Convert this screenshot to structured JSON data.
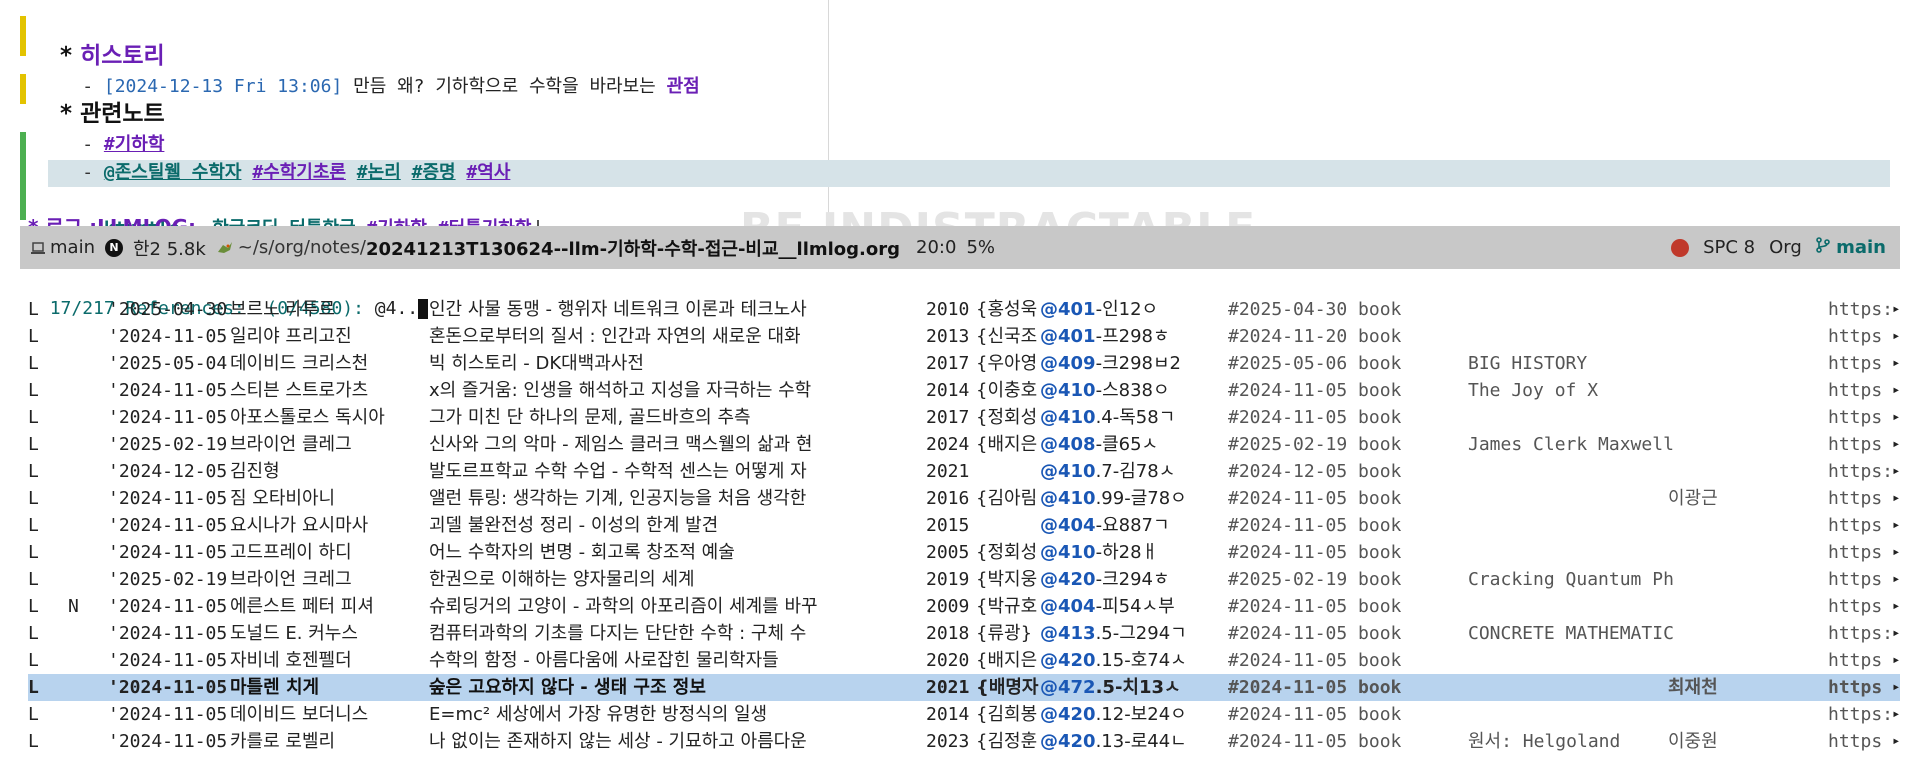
{
  "org": {
    "history_heading": "히스토리",
    "history_ts": "[2024-12-13 Fri 13:06]",
    "history_text": " 만듬 왜? 기하학으로 수학을 바라보는 ",
    "history_kw": "관점",
    "related_heading": "관련노트",
    "tag_geometry": "#기하학",
    "line3_links": [
      "@존스틸웰 수학자",
      "#수학기초론",
      "#논리",
      "#증명",
      "#역사"
    ],
    "kturtle_link": "kturtle - 한글코딩 터틀한글",
    "kturtle_tag1": "#기하학",
    "kturtle_tag2": "#터틀기하학",
    "partial_heading": "* 로그 :LLMLOG:",
    "watermark": "BE INDISTRACTABLE"
  },
  "modeline": {
    "workspace": "main",
    "badge": "N",
    "buffer_info": "한2 5.8k",
    "dir": "~/s/org/notes/",
    "filename": "20241213T130624--llm-기하학-수학-접근-비교__llmlog.org",
    "position": "20:0",
    "percent": "5%",
    "keys": "SPC 8",
    "mode": "Org",
    "branch": "main"
  },
  "prompt": {
    "label": "17/217 References:  (0/4580): ",
    "input": "@4.."
  },
  "references": [
    {
      "flag": "L",
      "n": "",
      "date": "'2025-04-30",
      "author": "브르노 라투르",
      "title": "인간 사물 동맹 - 행위자 네트워크 이론과 테크노사",
      "year": "2010",
      "trans": "{홍성욱",
      "call_at": "@401",
      "call": "-인12ㅇ",
      "tag": "#2025-04-30 book",
      "orig": "",
      "tr2": "",
      "url": "https:"
    },
    {
      "flag": "L",
      "n": "",
      "date": "'2024-11-05",
      "author": "일리야 프리고진",
      "title": "혼돈으로부터의 질서 : 인간과 자연의 새로운 대화",
      "year": "2013",
      "trans": "{신국조",
      "call_at": "@401",
      "call": "-프298ㅎ",
      "tag": "#2024-11-20 book",
      "orig": "",
      "tr2": "",
      "url": "https"
    },
    {
      "flag": "L",
      "n": "",
      "date": "'2025-05-04",
      "author": "데이비드 크리스천",
      "title": "빅 히스토리 - DK대백과사전",
      "year": "2017",
      "trans": "{우아영",
      "call_at": "@409",
      "call": "-크298ㅂ2",
      "tag": "#2025-05-06 book",
      "orig": "BIG HISTORY",
      "tr2": "",
      "url": "https"
    },
    {
      "flag": "L",
      "n": "",
      "date": "'2024-11-05",
      "author": "스티븐 스트로가츠",
      "title": "x의 즐거움: 인생을 해석하고 지성을 자극하는 수학",
      "year": "2014",
      "trans": "{이충호",
      "call_at": "@410",
      "call": "-스838ㅇ",
      "tag": "#2024-11-05 book",
      "orig": "The Joy of X",
      "tr2": "",
      "url": "https"
    },
    {
      "flag": "L",
      "n": "",
      "date": "'2024-11-05",
      "author": "아포스톨로스 독시아",
      "title": "그가 미친 단 하나의 문제, 골드바흐의 추측",
      "year": "2017",
      "trans": "{정회성",
      "call_at": "@410",
      "call": ".4-독58ㄱ",
      "tag": "#2024-11-05 book",
      "orig": "",
      "tr2": "",
      "url": "https"
    },
    {
      "flag": "L",
      "n": "",
      "date": "'2025-02-19",
      "author": "브라이언 클레그",
      "title": "신사와 그의 악마 - 제임스 클러크 맥스웰의 삶과 현",
      "year": "2024",
      "trans": "{배지은",
      "call_at": "@408",
      "call": "-클65ㅅ",
      "tag": "#2025-02-19 book",
      "orig": "James Clerk Maxwell",
      "tr2": "",
      "url": "https"
    },
    {
      "flag": "L",
      "n": "",
      "date": "'2024-12-05",
      "author": "김진형",
      "title": "발도르프학교 수학 수업 - 수학적 센스는 어떻게 자",
      "year": "2021",
      "trans": "",
      "call_at": "@410",
      "call": ".7-김78ㅅ",
      "tag": "#2024-12-05 book",
      "orig": "",
      "tr2": "",
      "url": "https:"
    },
    {
      "flag": "L",
      "n": "",
      "date": "'2024-11-05",
      "author": "짐 오타비아니",
      "title": "앨런 튜링: 생각하는 기계, 인공지능을 처음 생각한",
      "year": "2016",
      "trans": "{김아림",
      "call_at": "@410",
      "call": ".99-글78ㅇ",
      "tag": "#2024-11-05 book",
      "orig": "",
      "tr2": "이광근",
      "url": "https"
    },
    {
      "flag": "L",
      "n": "",
      "date": "'2024-11-05",
      "author": "요시나가 요시마사",
      "title": "괴델 불완전성 정리 - 이성의 한계 발견",
      "year": "2015",
      "trans": "",
      "call_at": "@404",
      "call": "-요887ㄱ",
      "tag": "#2024-11-05 book",
      "orig": "",
      "tr2": "",
      "url": "https"
    },
    {
      "flag": "L",
      "n": "",
      "date": "'2024-11-05",
      "author": "고드프레이 하디",
      "title": "어느 수학자의 변명 - 회고록 창조적 예술",
      "year": "2005",
      "trans": "{정회성",
      "call_at": "@410",
      "call": "-하28ㅐ",
      "tag": "#2024-11-05 book",
      "orig": "",
      "tr2": "",
      "url": "https"
    },
    {
      "flag": "L",
      "n": "",
      "date": "'2025-02-19",
      "author": "브라이언 크레그",
      "title": "한권으로 이해하는 양자물리의 세계",
      "year": "2019",
      "trans": "{박지웅",
      "call_at": "@420",
      "call": "-크294ㅎ",
      "tag": "#2025-02-19 book",
      "orig": "Cracking Quantum Ph",
      "tr2": "",
      "url": "https"
    },
    {
      "flag": "L",
      "n": "N",
      "date": "'2024-11-05",
      "author": "에른스트 페터 피셔",
      "title": "슈뢰딩거의 고양이 - 과학의 아포리즘이 세계를 바꾸",
      "year": "2009",
      "trans": "{박규호",
      "call_at": "@404",
      "call": "-피54ㅅ부",
      "tag": "#2024-11-05 book",
      "orig": "",
      "tr2": "",
      "url": "https"
    },
    {
      "flag": "L",
      "n": "",
      "date": "'2024-11-05",
      "author": "도널드 E. 커누스",
      "title": "컴퓨터과학의 기초를 다지는 단단한 수학 : 구체 수",
      "year": "2018",
      "trans": "{류광}",
      "call_at": "@413",
      "call": ".5-그294ㄱ",
      "tag": "#2024-11-05 book",
      "orig": "CONCRETE MATHEMATIC",
      "tr2": "",
      "url": "https:"
    },
    {
      "flag": "L",
      "n": "",
      "date": "'2024-11-05",
      "author": "자비네 호젠펠더",
      "title": "수학의 함정 - 아름다움에 사로잡힌 물리학자들",
      "year": "2020",
      "trans": "{배지은",
      "call_at": "@420",
      "call": ".15-호74ㅅ",
      "tag": "#2024-11-05 book",
      "orig": "",
      "tr2": "",
      "url": "https"
    },
    {
      "flag": "L",
      "n": "",
      "date": "'2024-11-05",
      "author": "마틀렌 치게",
      "title": "숲은 고요하지 않다 - 생태 구조 정보",
      "year": "2021",
      "trans": "{배명자",
      "call_at": "@472",
      "call": ".5-치13ㅅ",
      "tag": "#2024-11-05 book",
      "orig": "",
      "tr2": "최재천",
      "url": "https",
      "selected": true
    },
    {
      "flag": "L",
      "n": "",
      "date": "'2024-11-05",
      "author": "데이비드 보더니스",
      "title": "E=mc² 세상에서 가장 유명한 방정식의 일생",
      "year": "2014",
      "trans": "{김희봉",
      "call_at": "@420",
      "call": ".12-보24ㅇ",
      "tag": "#2024-11-05 book",
      "orig": "",
      "tr2": "",
      "url": "https:"
    },
    {
      "flag": "L",
      "n": "",
      "date": "'2024-11-05",
      "author": "카를로 로벨리",
      "title": "나 없이는 존재하지 않는 세상 - 기묘하고 아름다운",
      "year": "2023",
      "trans": "{김정훈",
      "call_at": "@420",
      "call": ".13-로44ㄴ",
      "tag": "#2024-11-05 book",
      "orig": "원서: Helgoland",
      "tr2": "이중원",
      "url": "https"
    }
  ]
}
